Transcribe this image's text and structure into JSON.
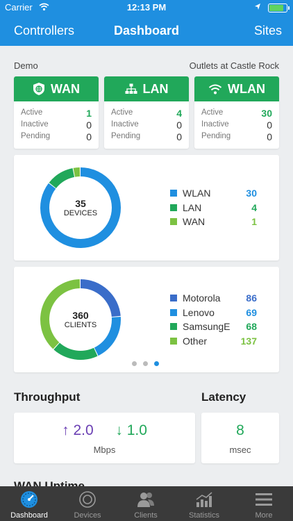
{
  "status": {
    "carrier": "Carrier",
    "time": "12:13 PM"
  },
  "nav": {
    "left": "Controllers",
    "title": "Dashboard",
    "right": "Sites"
  },
  "site": {
    "name": "Demo",
    "location": "Outlets at Castle Rock"
  },
  "networks": [
    {
      "name": "WAN",
      "icon": "shield-globe-icon",
      "active_label": "Active",
      "active": "1",
      "inactive_label": "Inactive",
      "inactive": "0",
      "pending_label": "Pending",
      "pending": "0"
    },
    {
      "name": "LAN",
      "icon": "network-tree-icon",
      "active_label": "Active",
      "active": "4",
      "inactive_label": "Inactive",
      "inactive": "0",
      "pending_label": "Pending",
      "pending": "0"
    },
    {
      "name": "WLAN",
      "icon": "wifi-icon",
      "active_label": "Active",
      "active": "30",
      "inactive_label": "Inactive",
      "inactive": "0",
      "pending_label": "Pending",
      "pending": "0"
    }
  ],
  "devices": {
    "total": "35",
    "label": "DEVICES",
    "items": [
      {
        "label": "WLAN",
        "value": "30",
        "count": 30,
        "color": "#1f8fe0"
      },
      {
        "label": "LAN",
        "value": "4",
        "count": 4,
        "color": "#21a85a"
      },
      {
        "label": "WAN",
        "value": "1",
        "count": 1,
        "color": "#7cc242"
      }
    ]
  },
  "clients": {
    "total": "360",
    "label": "CLIENTS",
    "items": [
      {
        "label": "Motorola",
        "value": "86",
        "count": 86,
        "color": "#3a6dc9"
      },
      {
        "label": "Lenovo",
        "value": "69",
        "count": 69,
        "color": "#1f8fe0"
      },
      {
        "label": "SamsungE",
        "value": "68",
        "count": 68,
        "color": "#21a85a"
      },
      {
        "label": "Other",
        "value": "137",
        "count": 137,
        "color": "#7cc242"
      }
    ],
    "page": 3,
    "pages": 3
  },
  "throughput": {
    "title": "Throughput",
    "up": "2.0",
    "down": "1.0",
    "unit": "Mbps"
  },
  "latency": {
    "title": "Latency",
    "value": "8",
    "unit": "msec"
  },
  "next_section": "WAN Uptime",
  "tabs": [
    {
      "label": "Dashboard",
      "icon": "gauge-icon",
      "active": true
    },
    {
      "label": "Devices",
      "icon": "devices-icon",
      "active": false
    },
    {
      "label": "Clients",
      "icon": "clients-icon",
      "active": false
    },
    {
      "label": "Statistics",
      "icon": "statistics-icon",
      "active": false
    },
    {
      "label": "More",
      "icon": "menu-icon",
      "active": false
    }
  ]
}
